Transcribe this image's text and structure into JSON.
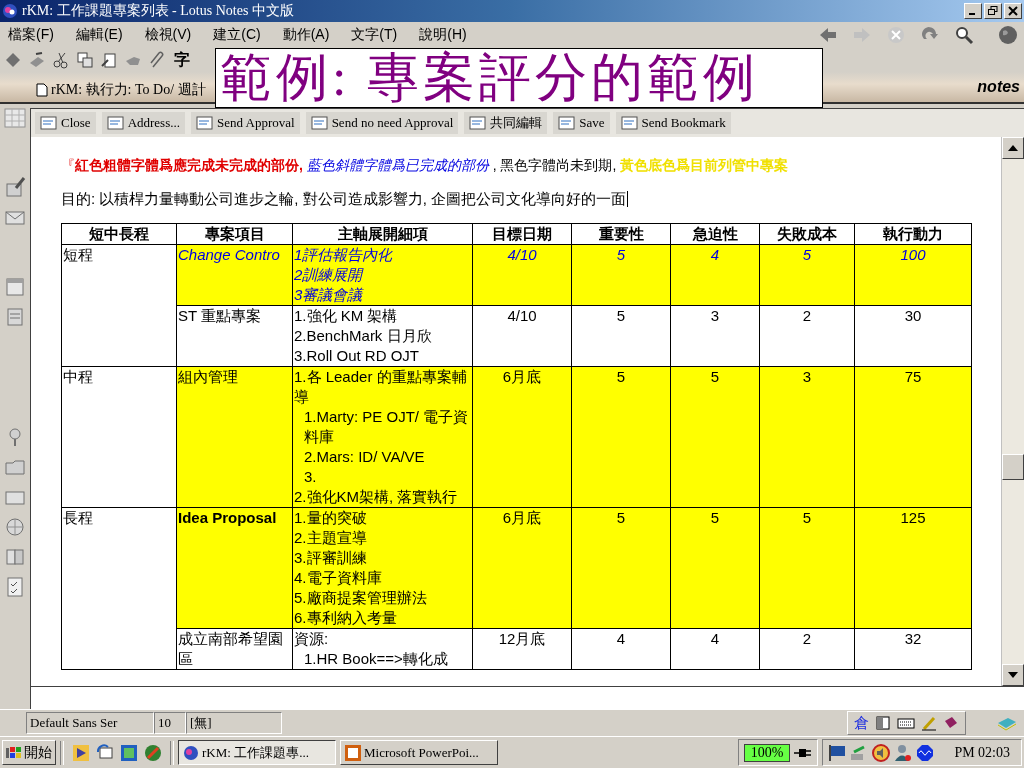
{
  "window": {
    "title": "rKM: 工作課題專案列表 - Lotus Notes 中文版"
  },
  "menu": [
    "檔案(F)",
    "編輯(E)",
    "檢視(V)",
    "建立(C)",
    "動作(A)",
    "文字(T)",
    "說明(H)"
  ],
  "toolbar": {
    "glyph": "字"
  },
  "document_tab": {
    "label": "rKM: 執行力: To Do/ 週計"
  },
  "brand": "notes",
  "overlay_caption": "範例: 專案評分的範例",
  "actions": [
    {
      "label": "Close"
    },
    {
      "label": "Address..."
    },
    {
      "label": "Send Approval"
    },
    {
      "label": "Send no need Approval"
    },
    {
      "label": "共同編輯"
    },
    {
      "label": "Save"
    },
    {
      "label": "Send Bookmark"
    }
  ],
  "legend": [
    {
      "kind": "mark",
      "text": "『"
    },
    {
      "kind": "overdue",
      "text": "紅色粗體字體爲應完成未完成的部份,"
    },
    {
      "kind": "done",
      "text": " 藍色斜體字體爲已完成的部份"
    },
    {
      "kind": "plain",
      "text": " , 黑色字體尚未到期,"
    },
    {
      "kind": "current",
      "text": " 黃色底色爲目前列管中專案"
    }
  ],
  "purpose": "目的: 以積桿力量轉動公司進步之輪, 對公司造成影響力, 企圖把公司文化導向好的一面",
  "table": {
    "columns": [
      "短中長程",
      "專案項目",
      "主軸展開細項",
      "目標日期",
      "重要性",
      "急迫性",
      "失敗成本",
      "執行動力"
    ],
    "groups": [
      {
        "term": "短程",
        "projects": [
          {
            "name": "Change Contro",
            "name_bold": false,
            "kind": "done",
            "current": true,
            "details": [
              {
                "text": "1評估報告內化"
              },
              {
                "text": "2訓練展開"
              },
              {
                "text": "3審議會議"
              }
            ],
            "target_date": "4/10",
            "importance": "5",
            "urgency": "4",
            "failure_cost": "5",
            "drive": "100"
          },
          {
            "name": "ST 重點專案",
            "name_bold": false,
            "kind": "plain",
            "current": false,
            "details": [
              {
                "text": "1.強化 KM 架構"
              },
              {
                "text": "2.BenchMark 日月欣"
              },
              {
                "text": "3.Roll Out RD OJT"
              }
            ],
            "target_date": "4/10",
            "importance": "5",
            "urgency": "3",
            "failure_cost": "2",
            "drive": "30"
          }
        ]
      },
      {
        "term": "中程",
        "projects": [
          {
            "name": "組內管理",
            "name_bold": false,
            "kind": "plain",
            "current": true,
            "details": [
              {
                "text": "1.各 Leader 的重點專案輔導",
                "children": [
                  {
                    "text": "1.Marty: PE OJT/ 電子資料庫"
                  },
                  {
                    "text": "2.Mars: ID/ VA/VE"
                  },
                  {
                    "text": "3."
                  }
                ]
              },
              {
                "text": "2.強化KM架構, 落實執行"
              }
            ],
            "target_date": "6月底",
            "importance": "5",
            "urgency": "5",
            "failure_cost": "3",
            "drive": "75"
          }
        ]
      },
      {
        "term": "長程",
        "projects": [
          {
            "name": "Idea Proposal",
            "name_bold": true,
            "kind": "plain",
            "current": true,
            "details": [
              {
                "text": "1.量的突破"
              },
              {
                "text": "2.主題宣導"
              },
              {
                "text": "3.評審訓練"
              },
              {
                "text": "4.電子資料庫"
              },
              {
                "text": "5.廠商提案管理辦法"
              },
              {
                "text": "6.專利納入考量"
              }
            ],
            "target_date": "6月底",
            "importance": "5",
            "urgency": "5",
            "failure_cost": "5",
            "drive": "125"
          },
          {
            "name": "成立南部希望園區",
            "name_bold": false,
            "kind": "plain",
            "current": false,
            "details": [
              {
                "text": "資源:",
                "children": [
                  {
                    "text": "1.HR Book==>轉化成"
                  }
                ]
              }
            ],
            "target_date": "12月底",
            "importance": "4",
            "urgency": "4",
            "failure_cost": "2",
            "drive": "32"
          }
        ]
      }
    ]
  },
  "status_bar": {
    "font": "Default Sans Ser",
    "size": "10",
    "style": "[無]",
    "ime": "倉"
  },
  "taskbar": {
    "start": "開始",
    "tasks": [
      {
        "label": "rKM: 工作課題專...",
        "selected": true
      },
      {
        "label": "Microsoft PowerPoi...",
        "selected": false
      }
    ],
    "battery": "100%",
    "clock": "PM 02:03"
  }
}
